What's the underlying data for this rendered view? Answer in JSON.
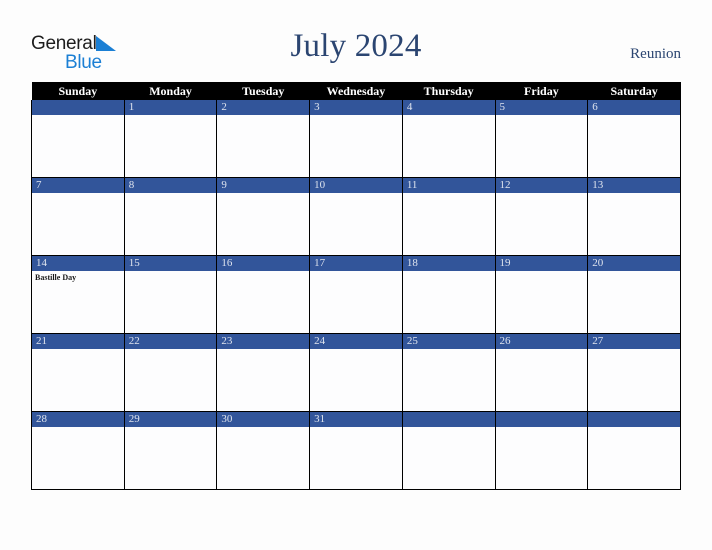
{
  "header": {
    "logo": {
      "text_primary": "General",
      "text_secondary": "Blue",
      "triangle_color": "#1b7fd4",
      "primary_color": "#1d1d1d",
      "secondary_color": "#1b7fd4"
    },
    "title": "July 2024",
    "region": "Reunion"
  },
  "colors": {
    "accent_blue": "#32559a",
    "header_row_bg": "#000000",
    "header_row_text": "#ffffff",
    "day_number_text": "#dfe4ee",
    "title_text": "#2b4571",
    "cell_bg": "#fdfdfe",
    "page_bg": "#fdfdfd",
    "grid_line": "#000000"
  },
  "calendar": {
    "weekday_headers": [
      "Sunday",
      "Monday",
      "Tuesday",
      "Wednesday",
      "Thursday",
      "Friday",
      "Saturday"
    ],
    "weeks": [
      [
        {
          "day": "",
          "events": []
        },
        {
          "day": "1",
          "events": []
        },
        {
          "day": "2",
          "events": []
        },
        {
          "day": "3",
          "events": []
        },
        {
          "day": "4",
          "events": []
        },
        {
          "day": "5",
          "events": []
        },
        {
          "day": "6",
          "events": []
        }
      ],
      [
        {
          "day": "7",
          "events": []
        },
        {
          "day": "8",
          "events": []
        },
        {
          "day": "9",
          "events": []
        },
        {
          "day": "10",
          "events": []
        },
        {
          "day": "11",
          "events": []
        },
        {
          "day": "12",
          "events": []
        },
        {
          "day": "13",
          "events": []
        }
      ],
      [
        {
          "day": "14",
          "events": [
            "Bastille Day"
          ]
        },
        {
          "day": "15",
          "events": []
        },
        {
          "day": "16",
          "events": []
        },
        {
          "day": "17",
          "events": []
        },
        {
          "day": "18",
          "events": []
        },
        {
          "day": "19",
          "events": []
        },
        {
          "day": "20",
          "events": []
        }
      ],
      [
        {
          "day": "21",
          "events": []
        },
        {
          "day": "22",
          "events": []
        },
        {
          "day": "23",
          "events": []
        },
        {
          "day": "24",
          "events": []
        },
        {
          "day": "25",
          "events": []
        },
        {
          "day": "26",
          "events": []
        },
        {
          "day": "27",
          "events": []
        }
      ],
      [
        {
          "day": "28",
          "events": []
        },
        {
          "day": "29",
          "events": []
        },
        {
          "day": "30",
          "events": []
        },
        {
          "day": "31",
          "events": []
        },
        {
          "day": "",
          "events": []
        },
        {
          "day": "",
          "events": []
        },
        {
          "day": "",
          "events": []
        }
      ]
    ]
  }
}
